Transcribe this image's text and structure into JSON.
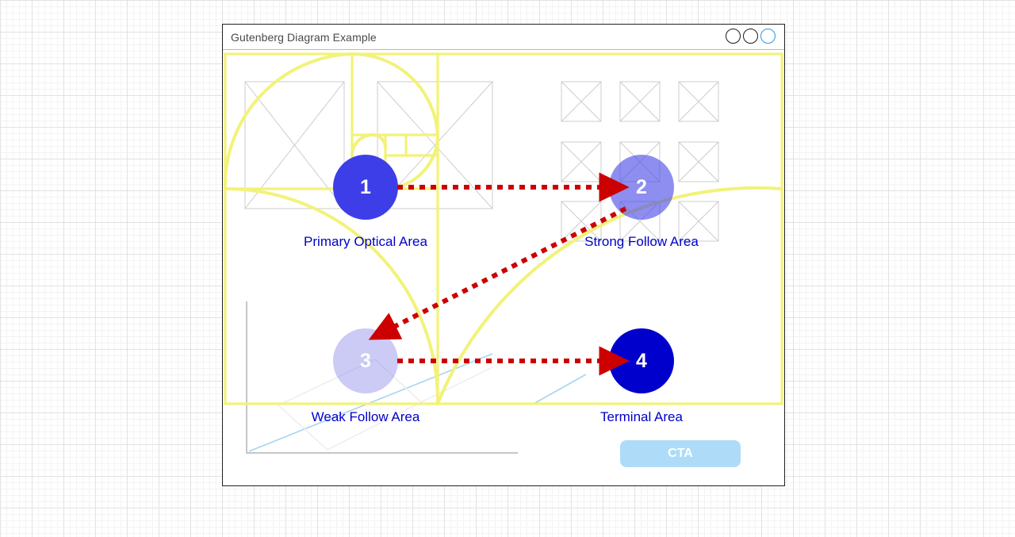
{
  "window": {
    "title": "Gutenberg Diagram Example",
    "controls": [
      {
        "name": "minimize",
        "style": "dark"
      },
      {
        "name": "maximize",
        "style": "dark"
      },
      {
        "name": "close",
        "style": "accent"
      }
    ]
  },
  "diagram": {
    "name": "Gutenberg Diagram",
    "accent_blue": "#0000cc",
    "arrow_color": "#cc0000",
    "golden_ratio_color": "#f2f27a",
    "wireframe_color": "#cccccc",
    "nodes": [
      {
        "number": "1",
        "label": "Primary Optical Area",
        "color": "#3e3ee8"
      },
      {
        "number": "2",
        "label": "Strong Follow Area",
        "color": "#7b7be6"
      },
      {
        "number": "3",
        "label": "Weak Follow Area",
        "color": "#c5c5f5"
      },
      {
        "number": "4",
        "label": "Terminal Area",
        "color": "#0000cc"
      }
    ],
    "reading_gravity_path": [
      "1",
      "2",
      "3",
      "4"
    ],
    "cta": {
      "label": "CTA",
      "color": "#aedcf8"
    }
  }
}
